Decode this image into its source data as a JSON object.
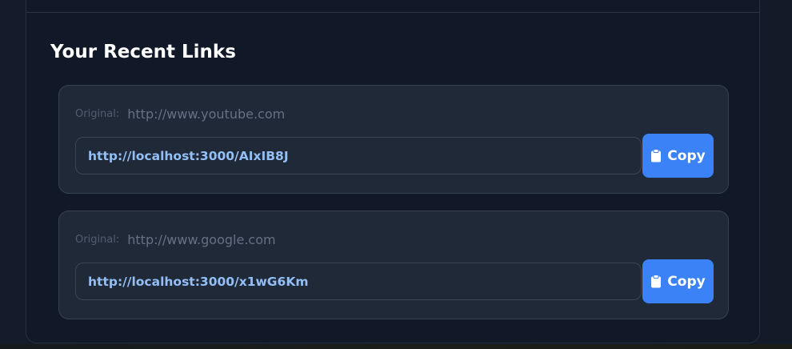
{
  "section": {
    "title": "Your Recent Links"
  },
  "links": [
    {
      "original_label": "Original:",
      "original_url": "http://www.youtube.com",
      "short_url": "http://localhost:3000/AIxIB8J",
      "copy_label": "Copy"
    },
    {
      "original_label": "Original:",
      "original_url": "http://www.google.com",
      "short_url": "http://localhost:3000/x1wG6Km",
      "copy_label": "Copy"
    }
  ],
  "icons": {
    "copy": "clipboard-icon"
  },
  "colors": {
    "background": "#111827",
    "card": "#1f2937",
    "accent": "#3b82f6",
    "short_url_text": "#93bff6"
  }
}
